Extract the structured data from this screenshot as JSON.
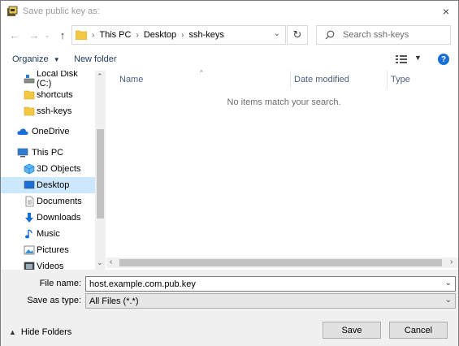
{
  "window": {
    "title": "Save public key as:",
    "close_icon": "×"
  },
  "address": {
    "crumbs": [
      "This PC",
      "Desktop",
      "ssh-keys"
    ]
  },
  "search": {
    "placeholder": "Search ssh-keys"
  },
  "toolbar": {
    "organize_label": "Organize",
    "new_folder_label": "New folder",
    "help_label": "?"
  },
  "nav_pane": {
    "items": [
      {
        "label": "Local Disk (C:)",
        "icon": "drive-icon",
        "selected": false
      },
      {
        "label": "shortcuts",
        "icon": "folder-icon",
        "selected": false
      },
      {
        "label": "ssh-keys",
        "icon": "folder-icon",
        "selected": false
      },
      {
        "label": "OneDrive",
        "icon": "cloud-icon",
        "selected": false
      },
      {
        "label": "This PC",
        "icon": "computer-icon",
        "selected": false
      },
      {
        "label": "3D Objects",
        "icon": "cube-icon",
        "selected": false
      },
      {
        "label": "Desktop",
        "icon": "desktop-icon",
        "selected": true
      },
      {
        "label": "Documents",
        "icon": "document-icon",
        "selected": false
      },
      {
        "label": "Downloads",
        "icon": "download-icon",
        "selected": false
      },
      {
        "label": "Music",
        "icon": "music-icon",
        "selected": false
      },
      {
        "label": "Pictures",
        "icon": "pictures-icon",
        "selected": false
      },
      {
        "label": "Videos",
        "icon": "videos-icon",
        "selected": false
      }
    ]
  },
  "file_list": {
    "columns": [
      "Name",
      "Date modified",
      "Type"
    ],
    "empty_message": "No items match your search."
  },
  "save_form": {
    "file_name_label": "File name:",
    "file_name_value": "host.example.com.pub.key",
    "save_as_type_label": "Save as type:",
    "save_as_type_value": "All Files (*.*)"
  },
  "footer": {
    "hide_folders_label": "Hide Folders",
    "save_label": "Save",
    "cancel_label": "Cancel"
  },
  "colors": {
    "selection": "#cce8ff",
    "help_blue": "#1a6ed8",
    "folder_yellow": "#f5c842"
  }
}
